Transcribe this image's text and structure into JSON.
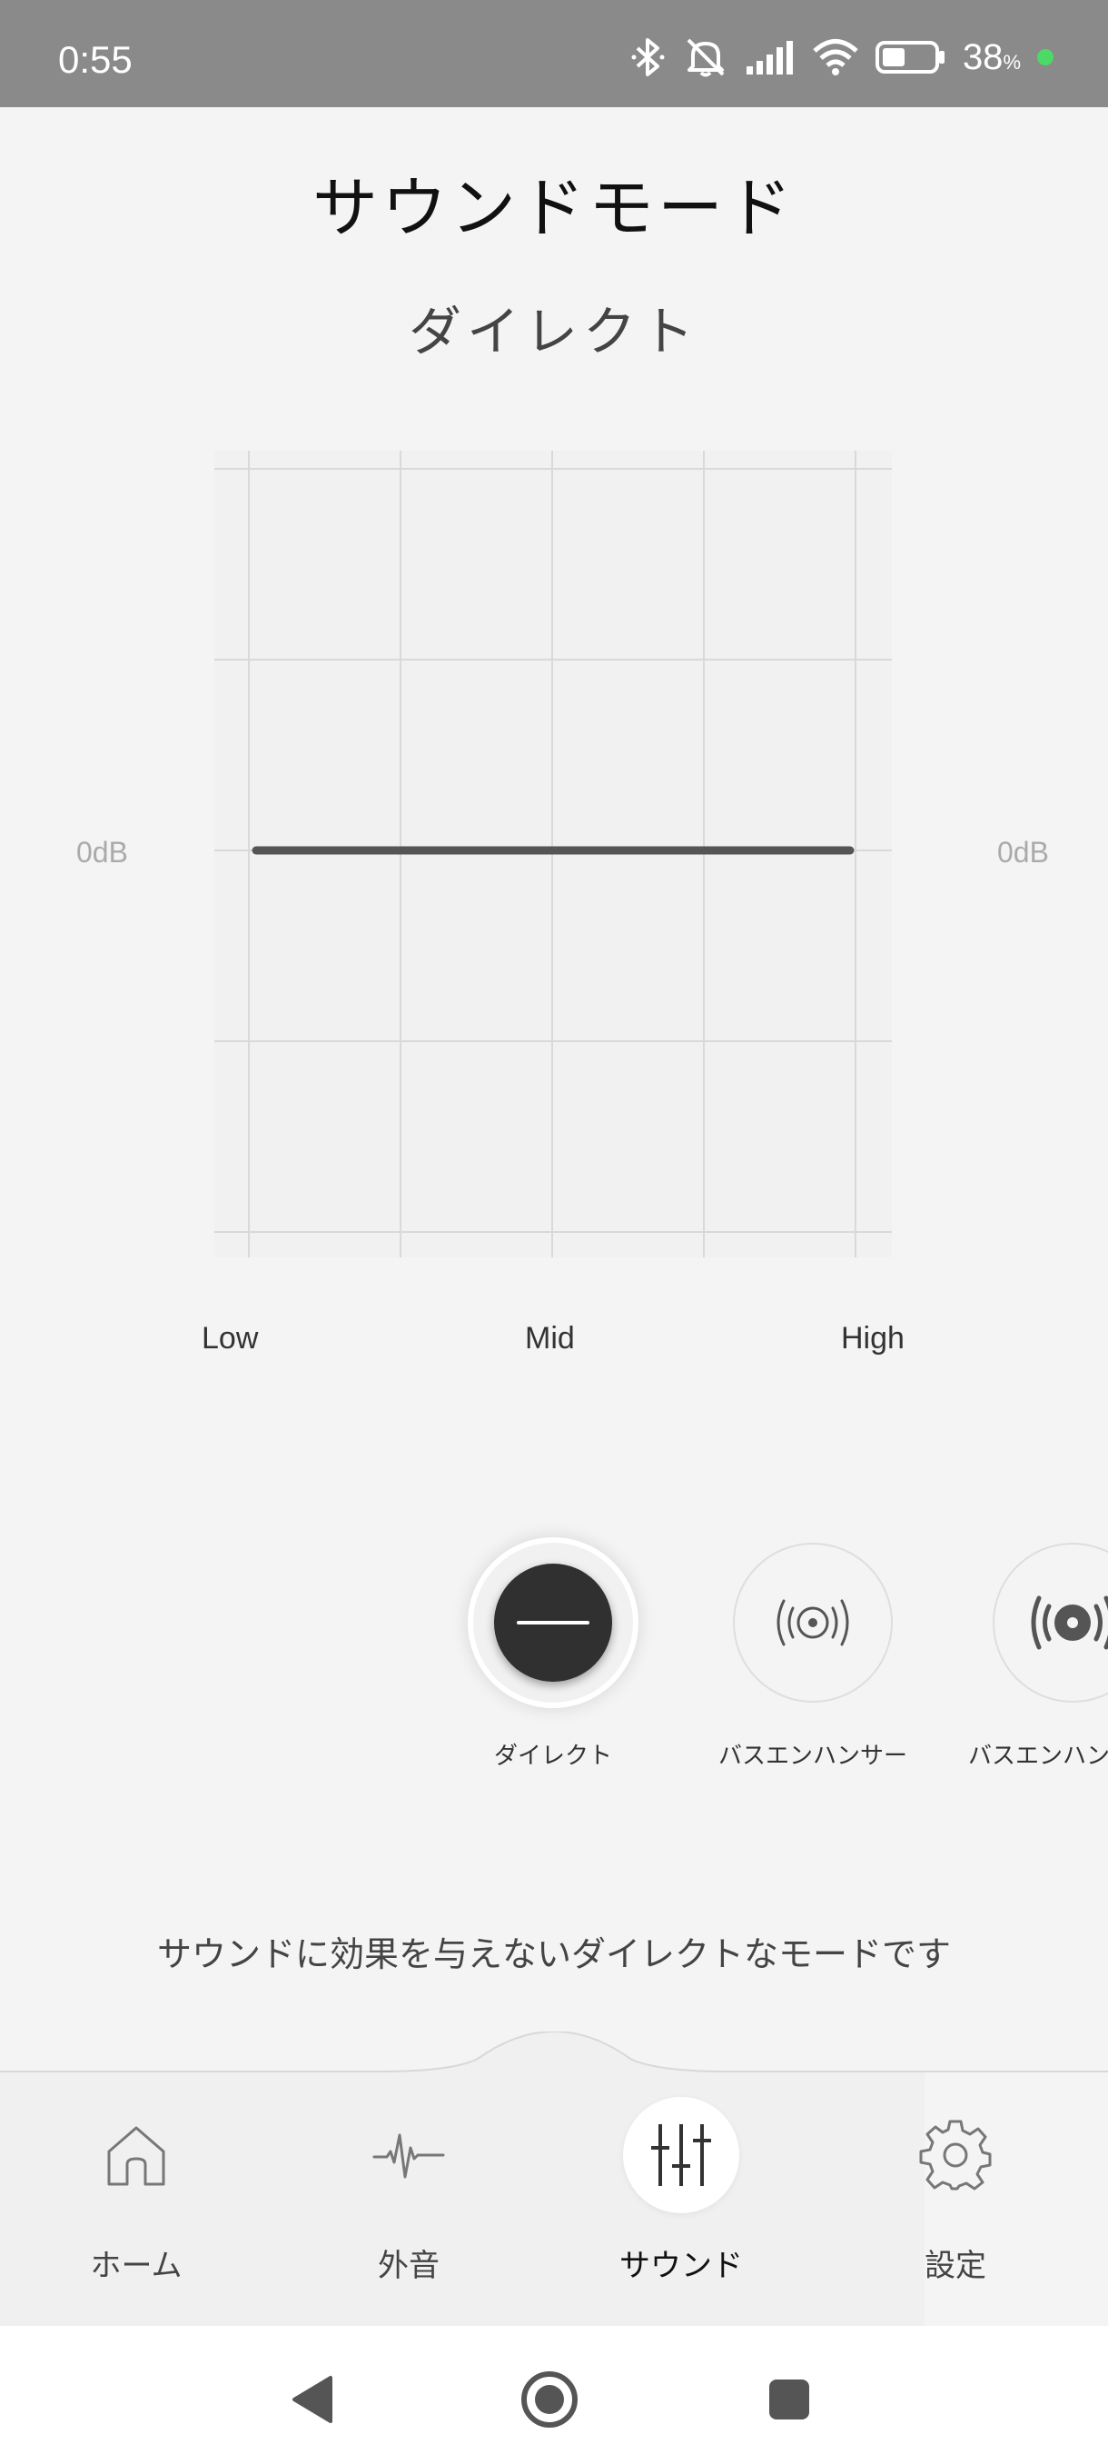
{
  "status_bar": {
    "time": "0:55",
    "battery_percent": "38",
    "battery_unit": "%",
    "icons": [
      "bluetooth-icon",
      "silent-icon",
      "signal-icon",
      "wifi-icon",
      "battery-icon"
    ]
  },
  "page": {
    "title": "サウンドモード",
    "mode_name": "ダイレクト",
    "description": "サウンドに効果を与えないダイレクトなモードです"
  },
  "eq": {
    "left_db_label": "0dB",
    "right_db_label": "0dB",
    "freq_labels": {
      "low": "Low",
      "mid": "Mid",
      "high": "High"
    },
    "curve_level_db": 0
  },
  "modes": [
    {
      "label": "ダイレクト",
      "icon": "direct-icon",
      "selected": true
    },
    {
      "label": "バスエンハンサー",
      "icon": "bass-enhancer-icon",
      "selected": false
    },
    {
      "label": "バスエンハン",
      "icon": "bass-enhancer-strong-icon",
      "selected": false
    }
  ],
  "bottom_nav": {
    "items": [
      {
        "label": "ホーム",
        "icon": "home-icon"
      },
      {
        "label": "外音",
        "icon": "ambient-sound-icon"
      },
      {
        "label": "サウンド",
        "icon": "equalizer-icon",
        "active": true
      },
      {
        "label": "設定",
        "icon": "gear-icon"
      }
    ]
  },
  "colors": {
    "background": "#f4f4f4",
    "status_bar": "#8a8a8a",
    "accent_dark": "#303030",
    "battery_dot": "#4cd964"
  }
}
